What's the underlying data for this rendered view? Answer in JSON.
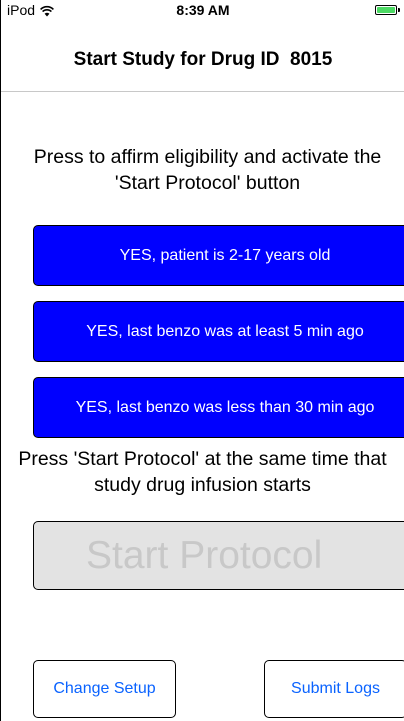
{
  "status_bar": {
    "device": "iPod",
    "wifi_icon": "wifi-icon",
    "time": "8:39 AM",
    "battery_icon": "battery-icon",
    "battery_color": "#4cd964"
  },
  "nav": {
    "title": "Start Study for Drug ID  8015"
  },
  "eligibility": {
    "instruction": "Press to affirm eligibility and activate the 'Start Protocol' button",
    "buttons": [
      {
        "label": "YES, patient is 2-17 years old"
      },
      {
        "label": "YES, last benzo was at least 5 min ago"
      },
      {
        "label": "YES, last benzo was less than 30 min ago"
      }
    ],
    "button_color": "#0000ff"
  },
  "protocol": {
    "instruction": "Press 'Start Protocol' at the same time that study drug infusion starts",
    "start_label": "Start Protocol",
    "enabled": false
  },
  "footer": {
    "change_setup_label": "Change Setup",
    "submit_logs_label": "Submit Logs",
    "link_color": "#0a63ff"
  }
}
